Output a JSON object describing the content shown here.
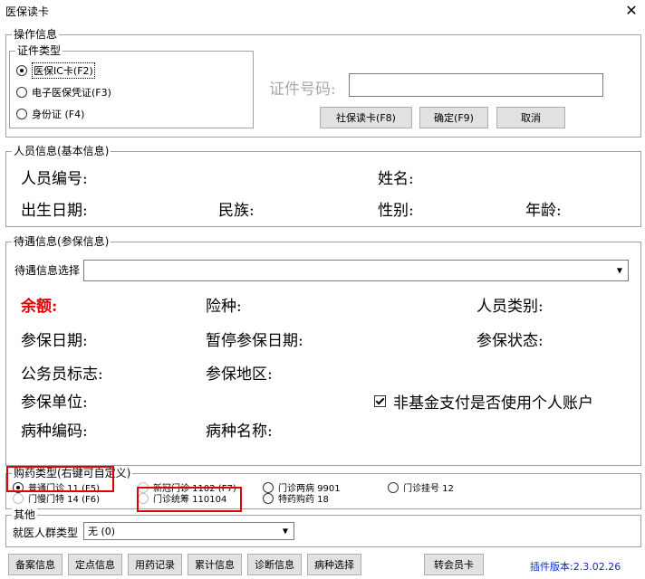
{
  "window": {
    "title": "医保读卡",
    "close_glyph": "✕"
  },
  "operation": {
    "legend": "操作信息",
    "id_type": {
      "legend": "证件类型",
      "options": [
        {
          "label": "医保IC卡(F2)",
          "checked": true
        },
        {
          "label": "电子医保凭证(F3)",
          "checked": false
        },
        {
          "label": "身份证  (F4)",
          "checked": false
        }
      ]
    },
    "id_number_label": "证件号码:",
    "id_number_value": "",
    "buttons": {
      "read_card": "社保读卡(F8)",
      "confirm": "确定(F9)",
      "cancel": "取消"
    }
  },
  "person": {
    "legend": "人员信息(基本信息)",
    "labels": {
      "person_no": "人员编号:",
      "name": "姓名:",
      "birth_date": "出生日期:",
      "ethnicity": "民族:",
      "gender": "性别:",
      "age": "年龄:"
    }
  },
  "benefit": {
    "legend": "待遇信息(参保信息)",
    "select_label": "待遇信息选择",
    "select_value": "",
    "labels": {
      "balance": "余额:",
      "insurance_type": "险种:",
      "person_category": "人员类别:",
      "insured_date": "参保日期:",
      "suspend_date": "暂停参保日期:",
      "insured_status": "参保状态:",
      "civil_servant": "公务员标志:",
      "insured_area": "参保地区:",
      "insured_unit": "参保单位:",
      "disease_code": "病种编码:",
      "disease_name": "病种名称:"
    },
    "personal_account_checkbox": {
      "label": "非基金支付是否使用个人账户",
      "checked": true
    }
  },
  "purchase": {
    "legend": "购药类型(右键可自定义)",
    "options": [
      {
        "label": "普通门诊 11 (F5)",
        "checked": true
      },
      {
        "label": "门慢门特 14 (F6)",
        "checked": false
      },
      {
        "label": "新冠门诊 1102 (F7)",
        "checked": false
      },
      {
        "label": "门诊统筹 110104",
        "checked": false
      },
      {
        "label": "门诊两病 9901",
        "checked": false
      },
      {
        "label": "特药购药 18",
        "checked": false
      },
      {
        "label": "门诊挂号 12",
        "checked": false
      }
    ]
  },
  "other": {
    "legend": "其他",
    "population_label": "就医人群类型",
    "population_value": "无 (0)"
  },
  "bottom_buttons": [
    "备案信息",
    "定点信息",
    "用药记录",
    "累计信息",
    "诊断信息",
    "病种选择",
    "转会员卡"
  ],
  "plugin_version": "插件版本:2.3.02.26",
  "colors": {
    "highlight_red": "#e00000",
    "version_blue": "#1030c0",
    "button_face": "#e1e1e1"
  }
}
